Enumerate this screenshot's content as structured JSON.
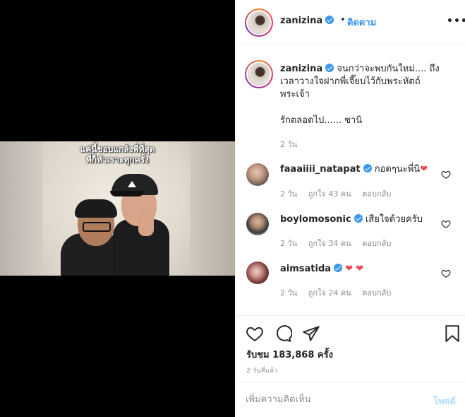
{
  "media": {
    "overlay_line1": "แค่นี้ชอบแกล้งพี่ที่สุด",
    "overlay_line2": "พี่ก็หัวเราะทุกครั้ง"
  },
  "header": {
    "username": "zanizina",
    "dot": "•",
    "follow_label": "ติดตาม",
    "more_icon": "more-options-icon",
    "more_glyph": "•••"
  },
  "caption": {
    "username": "zanizina",
    "line1": "จนกว่าจะพบกันใหม่.... ถึง",
    "line2": "เวลาวางใจฝากพี่เจี๊ยบไว้กับพระหัตถ์",
    "line3": "พระเจ้า",
    "line4": "รักตลอดไป...... ซานิ",
    "age": "2 วัน"
  },
  "comments": [
    {
      "username": "faaaiiii_natapat",
      "text": "กอดๆนะพี่นิ",
      "emoji": "❤",
      "age": "2 วัน",
      "likes": "ถูกใจ 43 คน",
      "reply": "ตอบกลับ"
    },
    {
      "username": "boylomosonic",
      "text": "เสียใจด้วยครับ",
      "emoji": "",
      "age": "2 วัน",
      "likes": "ถูกใจ 34 คน",
      "reply": "ตอบกลับ"
    },
    {
      "username": "aimsatida",
      "text": "",
      "emoji": "❤ ❤",
      "age": "2 วัน",
      "likes": "ถูกใจ 24 คน",
      "reply": "ตอบกลับ"
    }
  ],
  "actions": {
    "views": "รับชม 183,868 ครั้ง",
    "time": "2 วันที่แล้ว"
  },
  "comment_box": {
    "placeholder": "เพิ่มความคิดเห็น",
    "post_label": "โพสต์"
  },
  "colors": {
    "accent": "#3897f0",
    "heart": "#ed4956",
    "muted": "#8e8e8e"
  }
}
